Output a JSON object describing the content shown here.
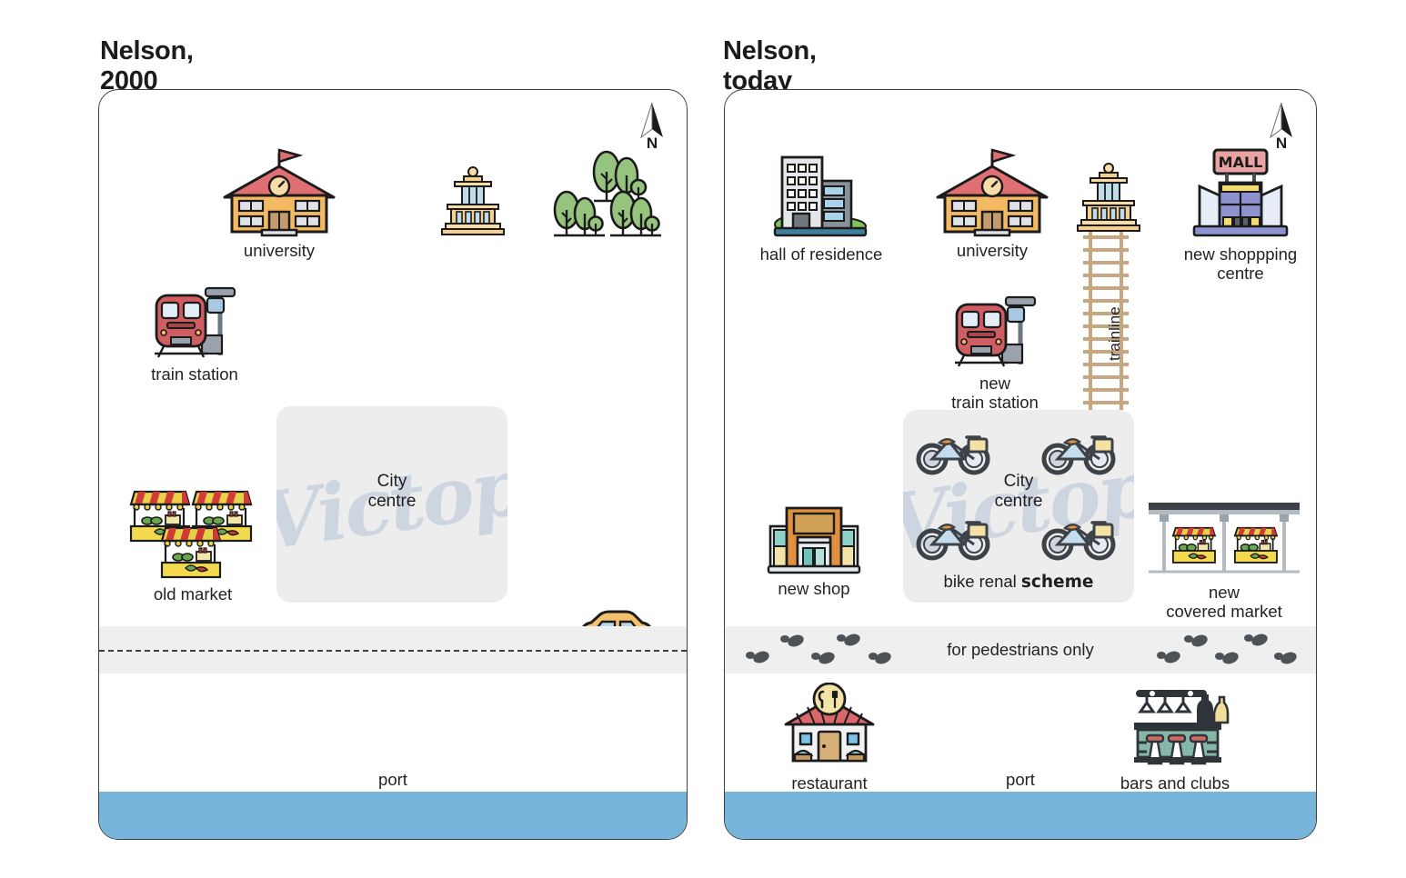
{
  "panels": [
    {
      "title": "Nelson, 2000",
      "compass": "N",
      "city_centre": {
        "label": "City\ncentre",
        "watermark": "Victop"
      },
      "road": {
        "type": "vehicle-road",
        "label": ""
      },
      "port_label": "port",
      "features": [
        {
          "key": "university",
          "label": "university",
          "icon": "university-icon"
        },
        {
          "key": "library",
          "label": "",
          "icon": "classical-building-icon"
        },
        {
          "key": "trees",
          "label": "",
          "icon": "trees-icon"
        },
        {
          "key": "train_station",
          "label": "train station",
          "icon": "train-station-icon"
        },
        {
          "key": "old_market",
          "label": "old market",
          "icon": "market-stalls-icon"
        },
        {
          "key": "car",
          "label": "",
          "icon": "car-icon"
        }
      ]
    },
    {
      "title": "Nelson, today",
      "compass": "N",
      "city_centre": {
        "label": "City\ncentre",
        "watermark": "Victop",
        "bottom_label_normal": "bike renal ",
        "bottom_label_bold": "scheme"
      },
      "road": {
        "type": "pedestrian-zone",
        "label": "for pedestrians only"
      },
      "port_label": "port",
      "trainline_label": "trainline",
      "features": [
        {
          "key": "hall_of_residence",
          "label": "hall of residence",
          "icon": "apartment-block-icon"
        },
        {
          "key": "university",
          "label": "university",
          "icon": "university-icon"
        },
        {
          "key": "library",
          "label": "",
          "icon": "classical-building-icon"
        },
        {
          "key": "shopping_centre",
          "label": "new shoppping\ncentre",
          "icon": "mall-icon",
          "sign": "MALL"
        },
        {
          "key": "new_train_station",
          "label": "new\ntrain station",
          "icon": "train-station-icon"
        },
        {
          "key": "new_shop",
          "label": "new shop",
          "icon": "shop-icon"
        },
        {
          "key": "covered_market",
          "label": "new\ncovered market",
          "icon": "covered-market-icon"
        },
        {
          "key": "restaurant",
          "label": "restaurant",
          "icon": "restaurant-icon"
        },
        {
          "key": "bars_and_clubs",
          "label": "bars and clubs",
          "icon": "bar-counter-icon"
        }
      ]
    }
  ],
  "colors": {
    "water": "#77b5dd",
    "road": "#efefef",
    "centre_box": "#ededed",
    "watermark": "#c3cedd",
    "roof_red": "#df6f72",
    "building_orange": "#f4b963",
    "tree_green": "#96c47f",
    "rail_tan": "#c6a77f",
    "mall_blue": "#8e93cf",
    "outline": "#1b1b1b"
  }
}
